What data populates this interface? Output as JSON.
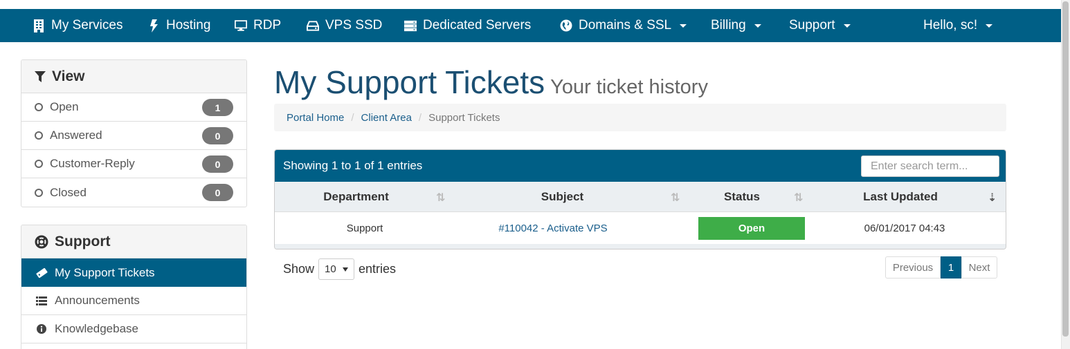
{
  "nav": {
    "items": [
      {
        "label": "My Services",
        "icon": "building-icon"
      },
      {
        "label": "Hosting",
        "icon": "bolt-icon"
      },
      {
        "label": "RDP",
        "icon": "desktop-icon"
      },
      {
        "label": "VPS SSD",
        "icon": "hdd-icon"
      },
      {
        "label": "Dedicated Servers",
        "icon": "server-icon"
      },
      {
        "label": "Domains & SSL",
        "icon": "globe-icon"
      },
      {
        "label": "Billing"
      },
      {
        "label": "Support"
      },
      {
        "label": "Hello, sc!"
      }
    ]
  },
  "view_panel": {
    "title": "View",
    "filters": [
      {
        "label": "Open",
        "count": "1"
      },
      {
        "label": "Answered",
        "count": "0"
      },
      {
        "label": "Customer-Reply",
        "count": "0"
      },
      {
        "label": "Closed",
        "count": "0"
      }
    ]
  },
  "support_panel": {
    "title": "Support",
    "items": [
      {
        "label": "My Support Tickets",
        "icon": "ticket-icon"
      },
      {
        "label": "Announcements",
        "icon": "list-icon"
      },
      {
        "label": "Knowledgebase",
        "icon": "info-icon"
      }
    ]
  },
  "page": {
    "title": "My Support Tickets",
    "subtitle": "Your ticket history"
  },
  "breadcrumb": {
    "items": [
      "Portal Home",
      "Client Area",
      "Support Tickets"
    ]
  },
  "table": {
    "info": "Showing 1 to 1 of 1 entries",
    "search_placeholder": "Enter search term...",
    "columns": [
      "Department",
      "Subject",
      "Status",
      "Last Updated"
    ],
    "rows": [
      {
        "department": "Support",
        "subject": "#110042 - Activate VPS",
        "status": "Open",
        "last_updated": "06/01/2017 04:43"
      }
    ]
  },
  "length": {
    "show": "Show",
    "value": "10",
    "entries": "entries"
  },
  "pager": {
    "previous": "Previous",
    "current": "1",
    "next": "Next"
  },
  "colors": {
    "primary": "#005f86",
    "status_open": "#3ead48",
    "badge": "#777777"
  }
}
